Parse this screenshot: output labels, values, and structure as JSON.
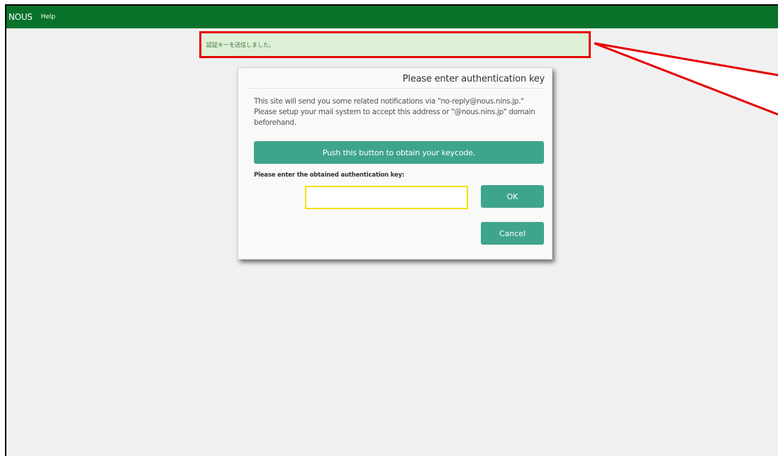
{
  "navbar": {
    "brand": "NOUS",
    "help_label": "Help"
  },
  "alert": {
    "message": "認証キーを送信しました。"
  },
  "modal": {
    "title": "Please enter authentication key",
    "message": "This site will send you some related notifications via \"no-reply@nous.nins.jp.\" Please setup your mail system to accept this address or \"@nous.nins.jp\" domain beforehand.",
    "keycode_button_label": "Push this button to obtain your keycode.",
    "key_label": "Please enter the obtained authentication key:",
    "key_input_value": "",
    "ok_label": "OK",
    "cancel_label": "Cancel"
  },
  "colors": {
    "navbar_bg": "#08722b",
    "button_teal": "#3fa48c",
    "alert_bg": "#dff0d8",
    "highlight_red": "#e50000",
    "input_highlight_yellow": "#f2e000"
  }
}
